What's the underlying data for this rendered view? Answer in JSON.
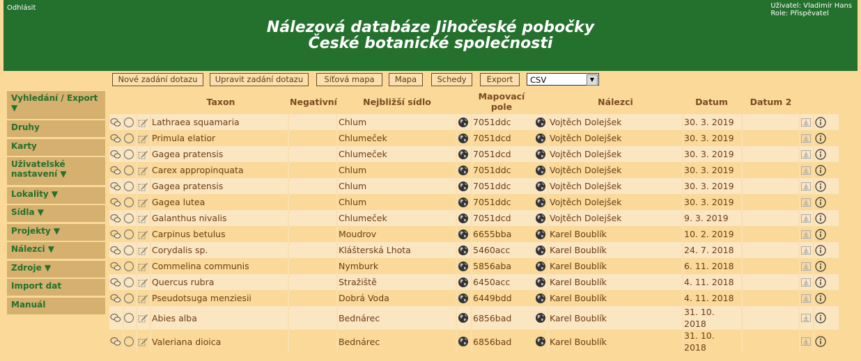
{
  "header": {
    "logout_label": "Odhlásit",
    "user_line": "Uživatel: Vladimír Hans",
    "role_line": "Role: Přispěvatel",
    "title_line1": "Nálezová databáze Jihočeské pobočky",
    "title_line2": "České botanické společnosti"
  },
  "toolbar": {
    "buttons": [
      "Nové zadání dotazu",
      "Upravit zadání dotazu",
      "Síťová mapa",
      "Mapa",
      "Schedy",
      "Export"
    ],
    "format_selected": "CSV"
  },
  "sidebar": {
    "items": [
      {
        "label": "Vyhledání / Export ▼"
      },
      {
        "label": "Druhy"
      },
      {
        "label": "Karty"
      },
      {
        "label": "Uživatelské nastavení ▼"
      },
      {
        "label": "Lokality ▼"
      },
      {
        "label": "Sídla ▼"
      },
      {
        "label": "Projekty ▼"
      },
      {
        "label": "Nálezci ▼"
      },
      {
        "label": "Zdroje ▼"
      },
      {
        "label": "Import dat"
      },
      {
        "label": "Manuál"
      }
    ]
  },
  "table": {
    "headers": {
      "taxon": "Taxon",
      "negative": "Negativní",
      "settlement": "Nejbližší sídlo",
      "grid": "Mapovací pole",
      "finders": "Nálezci",
      "date": "Datum",
      "date2": "Datum 2"
    },
    "rows": [
      {
        "taxon": "Lathraea squamaria",
        "negative": "",
        "settlement": "Chlum",
        "grid": "7051ddc",
        "finder": "Vojtěch Dolejšek",
        "date": "30. 3. 2019",
        "date2": ""
      },
      {
        "taxon": "Primula elatior",
        "negative": "",
        "settlement": "Chlumeček",
        "grid": "7051dcd",
        "finder": "Vojtěch Dolejšek",
        "date": "30. 3. 2019",
        "date2": ""
      },
      {
        "taxon": "Gagea pratensis",
        "negative": "",
        "settlement": "Chlumeček",
        "grid": "7051dcd",
        "finder": "Vojtěch Dolejšek",
        "date": "30. 3. 2019",
        "date2": ""
      },
      {
        "taxon": "Carex appropinquata",
        "negative": "",
        "settlement": "Chlum",
        "grid": "7051ddc",
        "finder": "Vojtěch Dolejšek",
        "date": "30. 3. 2019",
        "date2": ""
      },
      {
        "taxon": "Gagea pratensis",
        "negative": "",
        "settlement": "Chlum",
        "grid": "7051ddc",
        "finder": "Vojtěch Dolejšek",
        "date": "30. 3. 2019",
        "date2": ""
      },
      {
        "taxon": "Gagea lutea",
        "negative": "",
        "settlement": "Chlum",
        "grid": "7051ddc",
        "finder": "Vojtěch Dolejšek",
        "date": "30. 3. 2019",
        "date2": ""
      },
      {
        "taxon": "Galanthus nivalis",
        "negative": "",
        "settlement": "Chlumeček",
        "grid": "7051dcd",
        "finder": "Vojtěch Dolejšek",
        "date": "9. 3. 2019",
        "date2": ""
      },
      {
        "taxon": "Carpinus betulus",
        "negative": "",
        "settlement": "Moudrov",
        "grid": "6655bba",
        "finder": "Karel Boublík",
        "date": "10. 2. 2019",
        "date2": ""
      },
      {
        "taxon": "Corydalis sp.",
        "negative": "",
        "settlement": "Klášterská Lhota",
        "grid": "5460acc",
        "finder": "Karel Boublík",
        "date": "24. 7. 2018",
        "date2": ""
      },
      {
        "taxon": "Commelina communis",
        "negative": "",
        "settlement": "Nymburk",
        "grid": "5856aba",
        "finder": "Karel Boublík",
        "date": "6. 11. 2018",
        "date2": ""
      },
      {
        "taxon": "Quercus rubra",
        "negative": "",
        "settlement": "Stražiště",
        "grid": "6450acc",
        "finder": "Karel Boublík",
        "date": "4. 11. 2018",
        "date2": ""
      },
      {
        "taxon": "Pseudotsuga menziesii",
        "negative": "",
        "settlement": "Dobrá Voda",
        "grid": "6449bdd",
        "finder": "Karel Boublík",
        "date": "4. 11. 2018",
        "date2": ""
      },
      {
        "taxon": "Abies alba",
        "negative": "",
        "settlement": "Bednárec",
        "grid": "6856bad",
        "finder": "Karel Boublík",
        "date": "31. 10. 2018",
        "date2": ""
      },
      {
        "taxon": "Valeriana dioica",
        "negative": "",
        "settlement": "Bednárec",
        "grid": "6856bad",
        "finder": "Karel Boublík",
        "date": "31. 10. 2018",
        "date2": ""
      }
    ]
  },
  "colors": {
    "header_bg": "#24702d",
    "page_bg": "#fad999",
    "row_odd": "#fbe6c2",
    "row_even": "#fad999",
    "nav_bg": "#d5b06f",
    "nav_text": "#24702d"
  }
}
